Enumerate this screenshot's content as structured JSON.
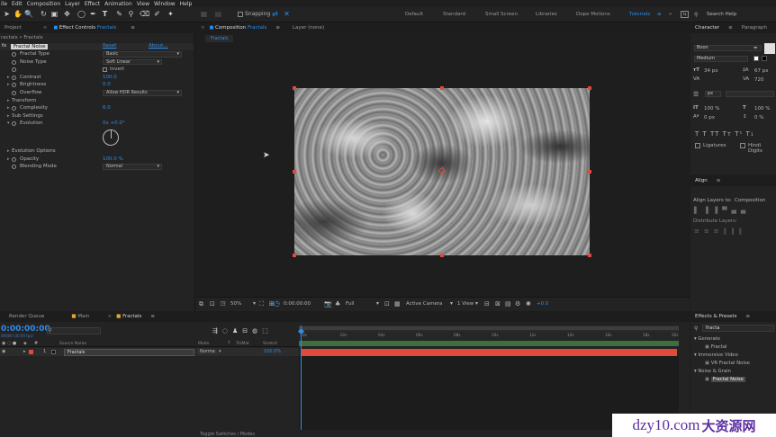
{
  "menu": [
    "ile",
    "Edit",
    "Composition",
    "Layer",
    "Effect",
    "Animation",
    "View",
    "Window",
    "Help"
  ],
  "toolbar": {
    "snapping_label": "Snapping",
    "workspaces": [
      "Default",
      "Standard",
      "Small Screen",
      "Libraries",
      "Dope Motions",
      "Tutorials"
    ],
    "active_workspace": "Tutorials",
    "search_placeholder": "Search Help"
  },
  "left_panel": {
    "tab_project": "Project",
    "tab_effect_controls": "Effect Controls",
    "tab_effect_controls_layer": "Fractals",
    "breadcrumb": "ractals • Fractals",
    "effect": {
      "fx": "fx",
      "name": "Fractal Noise",
      "reset": "Reset",
      "about": "About..."
    },
    "rows": [
      {
        "label": "Fractal Type",
        "dropdown": "Basic"
      },
      {
        "label": "Noise Type",
        "dropdown_short": "Soft Linear"
      },
      {
        "label": "",
        "checkbox": "Invert"
      },
      {
        "label": "Contrast",
        "value": "100.0",
        "twirl": true
      },
      {
        "label": "Brightness",
        "value": "0.0",
        "twirl": true
      },
      {
        "label": "Overflow",
        "dropdown": "Allow HDR Results"
      },
      {
        "label": "Transform",
        "twirl": true,
        "noicon": true
      },
      {
        "label": "Complexity",
        "value": "6.0",
        "twirl": true
      },
      {
        "label": "Sub Settings",
        "twirl": true,
        "noicon": true
      },
      {
        "label": "Evolution",
        "value": "0x +0.0°",
        "twirl": true,
        "open": true
      }
    ],
    "rows_after": [
      {
        "label": "Evolution Options",
        "twirl": true,
        "noicon": true
      },
      {
        "label": "Opacity",
        "value": "100.0 %",
        "twirl": true
      },
      {
        "label": "Blending Mode",
        "dropdown_short": "Normal"
      }
    ]
  },
  "viewer": {
    "tab_composition": "Composition",
    "tab_composition_name": "Fractals",
    "tab_layer": "Layer (none)",
    "comp_chip": "Fractals",
    "footer": {
      "zoom": "50%",
      "timecode": "0:00:00:00",
      "resolution": "Full",
      "camera": "Active Camera",
      "views": "1 View",
      "exposure": "+0.0"
    }
  },
  "character": {
    "tab_character": "Character",
    "tab_paragraph": "Paragraph",
    "font": "Boon",
    "style": "Medium",
    "font_size": "34 px",
    "leading": "67 px",
    "tracking": "720",
    "stroke_unit": "px",
    "v_scale": "100 %",
    "h_scale": "100 %",
    "baseline": "0 px",
    "tsume": "0 %",
    "ligatures": "Ligatures",
    "hindi_digits": "Hindi Digits"
  },
  "align": {
    "title": "Align",
    "align_to_label": "Align Layers to:",
    "align_to_value": "Composition",
    "distribute": "Distribute Layers:"
  },
  "timeline": {
    "tab_render_queue": "Render Queue",
    "tab_main": "Main",
    "tab_fractals": "Fractals",
    "timecode": "0:00:00:00",
    "fps": "00000 (30.00 fps)",
    "col_source": "Source Name",
    "col_mode": "Mode",
    "col_t": "T",
    "col_trkmat": "TrkMat",
    "col_stretch": "Stretch",
    "layer": {
      "index": "1",
      "name": "Fractals",
      "mode": "Norma",
      "stretch": "100.0%"
    },
    "ticks": [
      "0s",
      "02s",
      "04s",
      "06s",
      "08s",
      "10s",
      "12s",
      "14s",
      "16s",
      "18s"
    ],
    "end_tick": "20s",
    "footer": "Toggle Switches / Modes"
  },
  "effects": {
    "title": "Effects & Presets",
    "search": "fracta",
    "tree": [
      {
        "text": "Generate",
        "level": 0
      },
      {
        "text": "Fractal",
        "level": 1
      },
      {
        "text": "Immersive Video",
        "level": 0
      },
      {
        "text": "VR Fractal Noise",
        "level": 1
      },
      {
        "text": "Noise & Grain",
        "level": 0
      },
      {
        "text": "Fractal Noise",
        "level": 1,
        "selected": true
      }
    ]
  },
  "watermark": {
    "latin": "dzy10.com",
    "cjk": "大资源网"
  }
}
